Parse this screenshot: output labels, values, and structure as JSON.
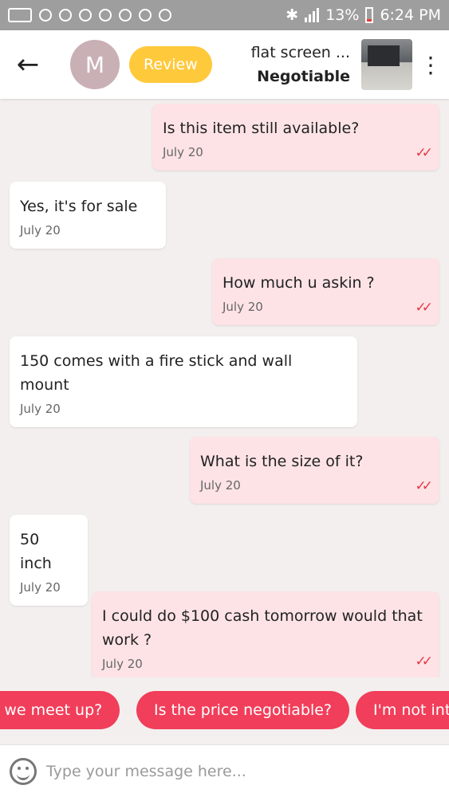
{
  "status_bar": {
    "battery": "13%",
    "time": "6:24 PM"
  },
  "header": {
    "avatar_letter": "M",
    "review_label": "Review",
    "item_title": "flat screen ...",
    "item_price": "Negotiable"
  },
  "messages": [
    {
      "dir": "out",
      "text": "Is this item still available?",
      "time": "July 20"
    },
    {
      "dir": "in",
      "text": "Yes, it's for sale",
      "time": "July 20"
    },
    {
      "dir": "out",
      "text": "How much u askin ?",
      "time": "July 20"
    },
    {
      "dir": "in",
      "text": "150 comes with a fire stick and wall mount",
      "time": "July 20"
    },
    {
      "dir": "out",
      "text": "What is the size of it?",
      "time": "July 20"
    },
    {
      "dir": "in",
      "text": "50 inch",
      "time": "July 20"
    },
    {
      "dir": "out",
      "text": "I could do $100 cash tomorrow would that work ?",
      "time": "July 20"
    }
  ],
  "quick_replies": [
    "ld we meet up?",
    "Is the price negotiable?",
    "I'm not int"
  ],
  "input": {
    "placeholder": "Type your message here..."
  },
  "colors": {
    "accent": "#f13e5a",
    "review": "#ffc93c",
    "outgoing_bubble": "#fde3e6",
    "tick": "#e53945"
  }
}
